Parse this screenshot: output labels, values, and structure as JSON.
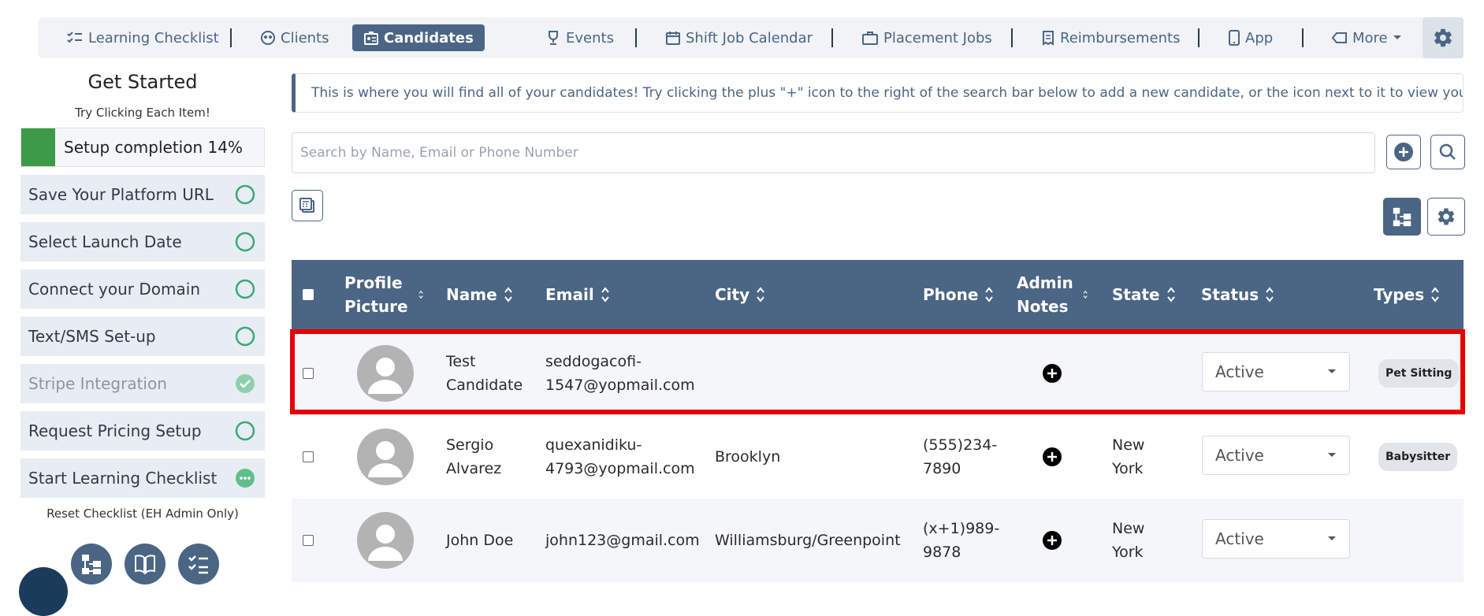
{
  "nav": {
    "items": [
      {
        "label": "Learning Checklist",
        "icon": "checklist-icon"
      },
      {
        "label": "Clients",
        "icon": "users-icon"
      },
      {
        "label": "Candidates",
        "icon": "id-badge-icon"
      },
      {
        "label": "Events",
        "icon": "trophy-icon"
      },
      {
        "label": "Shift Job Calendar",
        "icon": "calendar-icon"
      },
      {
        "label": "Placement Jobs",
        "icon": "briefcase-icon"
      },
      {
        "label": "Reimbursements",
        "icon": "receipt-icon"
      },
      {
        "label": "App",
        "icon": "mobile-icon"
      },
      {
        "label": "More",
        "icon": "tag-icon"
      }
    ],
    "active": "Candidates"
  },
  "sidebar": {
    "title": "Get Started",
    "subtitle": "Try Clicking Each Item!",
    "progress_label": "Setup completion 14%",
    "progress_fraction": 0.14,
    "items": [
      {
        "label": "Save Your Platform URL",
        "state": "todo"
      },
      {
        "label": "Select Launch Date",
        "state": "todo"
      },
      {
        "label": "Connect your Domain",
        "state": "todo"
      },
      {
        "label": "Text/SMS Set-up",
        "state": "todo"
      },
      {
        "label": "Stripe Integration",
        "state": "done"
      },
      {
        "label": "Request Pricing Setup",
        "state": "todo"
      },
      {
        "label": "Start Learning Checklist",
        "state": "in-progress"
      }
    ],
    "reset_label": "Reset Checklist (EH Admin Only)"
  },
  "info_text": "This is where you will find all of your candidates! Try clicking the plus \"+\" icon to the right of the search bar below to add a new candidate, or the icon next to it to view your .",
  "search": {
    "placeholder": "Search by Name, Email or Phone Number",
    "value": ""
  },
  "table": {
    "headers": {
      "profile": "Profile Picture",
      "name": "Name",
      "email": "Email",
      "city": "City",
      "phone": "Phone",
      "notes": "Admin Notes",
      "state": "State",
      "status": "Status",
      "types": "Types"
    },
    "rows": [
      {
        "name": "Test Candidate",
        "email": "seddogacofi-1547@yopmail.com",
        "city": "",
        "phone": "",
        "state": "",
        "status": "Active",
        "type": "Pet Sitting"
      },
      {
        "name": "Sergio Alvarez",
        "email": "quexanidiku-4793@yopmail.com",
        "city": "Brooklyn",
        "phone": "(555)234-7890",
        "state": "New York",
        "status": "Active",
        "type": "Babysitter"
      },
      {
        "name": "John Doe",
        "email": "john123@gmail.com",
        "city": "Williamsburg/Greenpoint",
        "phone": "(x+1)989-9878",
        "state": "New York",
        "status": "Active",
        "type": ""
      }
    ]
  },
  "colors": {
    "primary": "#4b6584",
    "success": "#3d9a47",
    "highlight": "#e60000",
    "circle": "#3aa876"
  }
}
